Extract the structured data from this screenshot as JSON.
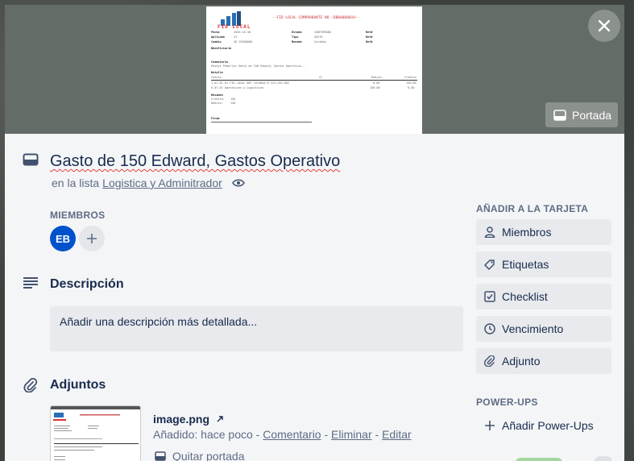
{
  "cover": {
    "doc_logo_text": "FID LOCAL",
    "doc_header": "--FID LOCAL COMPROBANTE NO.:BB0000001H--",
    "doc_fields": [
      {
        "label": "Fecha",
        "value": "2020-10-30",
        "label2": "Estado",
        "value2": "CONFIRMADO",
        "ref": "Ref#"
      },
      {
        "label": "Aplicado",
        "value": "SI",
        "label2": "Tipo",
        "value2": "GASTO",
        "ref": "Ref#"
      },
      {
        "label": "Cambio",
        "value": "36.75000000",
        "label2": "Moneda",
        "value2": "Cordoba",
        "ref": "Ref#"
      },
      {
        "label": "Beneficiario",
        "value": "",
        "label2": "",
        "value2": "",
        "ref": ""
      }
    ],
    "doc_comment_label": "Comentario",
    "doc_comment": "Pasaje Pabellon Gasto de 150 Edward, Gastos Operativo...",
    "doc_detail_label": "Detalle",
    "doc_detail_headers": [
      "Cuenta",
      "CC",
      "Debito",
      "Credito"
    ],
    "doc_detail_rows": [
      [
        "1-01-01-01 FID LOCAL ABC Cordoba B 223-245-002",
        "",
        "0.00",
        "150.00"
      ],
      [
        "6-07-01 Operativos y Logisticos",
        "",
        "150.00",
        "0.00"
      ]
    ],
    "doc_summary_label": "Resumen",
    "doc_summary": [
      [
        "Credito:",
        "150"
      ],
      [
        "Debito:",
        "150"
      ]
    ],
    "doc_sign_label": "Firma",
    "cover_button": "Portada"
  },
  "card": {
    "title": "Gasto de 150 Edward, Gastos Operativo",
    "list_prefix": "en la lista",
    "list_name": "Logistica y Adminitrador"
  },
  "members": {
    "label": "MIEMBROS",
    "avatar_initials": "EB"
  },
  "description": {
    "title": "Descripción",
    "placeholder": "Añadir una descripción más detallada..."
  },
  "attachments": {
    "title": "Adjuntos",
    "file_name": "image.png",
    "added_prefix": "Añadido: hace poco",
    "actions": [
      "Comentario",
      "Eliminar",
      "Editar"
    ],
    "separator": " - ",
    "remove_cover": "Quitar portada"
  },
  "sidebar": {
    "add_to_card_label": "AÑADIR A LA TARJETA",
    "buttons": [
      "Miembros",
      "Etiquetas",
      "Checklist",
      "Vencimiento",
      "Adjunto"
    ],
    "powerups_label": "POWER-UPS",
    "add_powerups": "Añadir Power-Ups"
  },
  "colors": {
    "avatar": "#0052cc",
    "cover_bg": "#646c67",
    "modal_bg": "#f4f5f7"
  }
}
